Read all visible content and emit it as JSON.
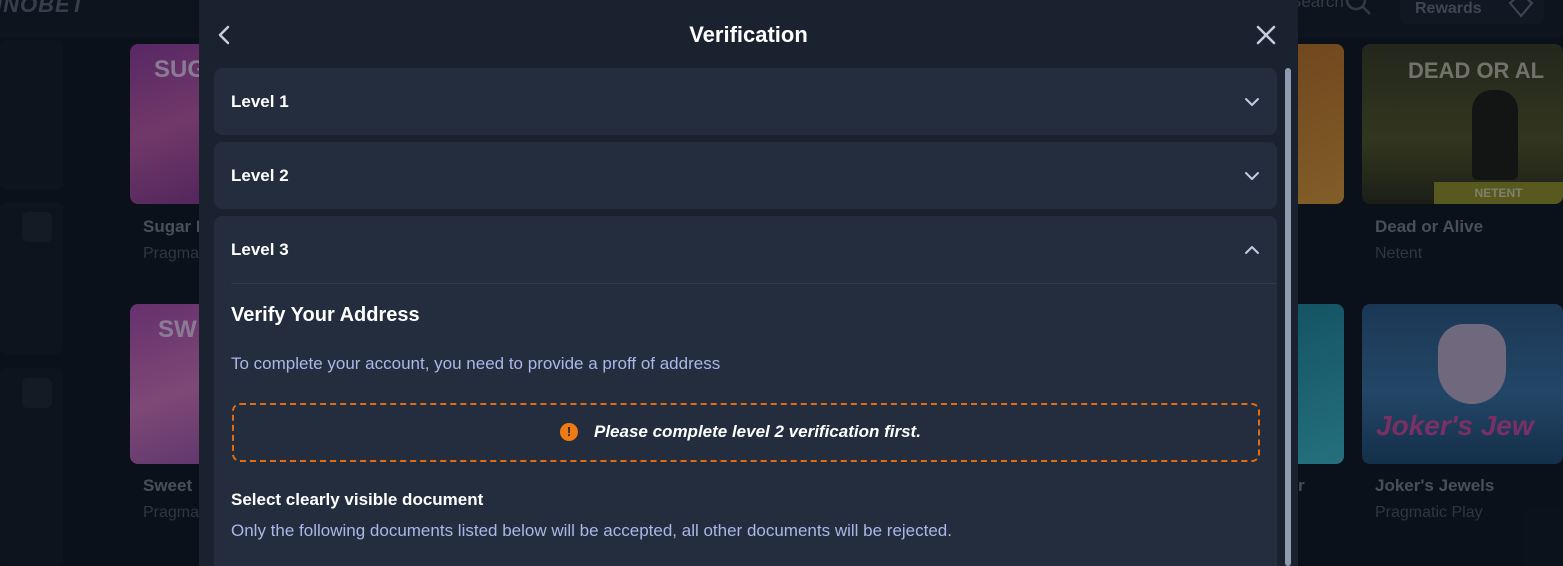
{
  "background": {
    "logo": "INOBET",
    "search_label": "Search",
    "rewards_label": "Rewards",
    "games": [
      {
        "title": "Sugar R",
        "provider": "Pragmatic",
        "banner": "SUG"
      },
      {
        "title": "Dead or Alive",
        "provider": "Netent",
        "banner": "DEAD OR AL",
        "badge": "NETENT"
      },
      {
        "title": "Sweet",
        "provider": "Pragmatic",
        "banner": "SW"
      },
      {
        "title": "r",
        "provider": ""
      },
      {
        "title": "Joker's Jewels",
        "provider": "Pragmatic Play",
        "banner": "Joker's Jew"
      }
    ]
  },
  "modal": {
    "title": "Verification",
    "levels": [
      {
        "label": "Level 1",
        "expanded": false
      },
      {
        "label": "Level 2",
        "expanded": false
      },
      {
        "label": "Level 3",
        "expanded": true
      }
    ],
    "level3": {
      "heading": "Verify Your Address",
      "description": "To complete your account, you need to provide a proff of address",
      "warning_icon": "!",
      "warning": "Please complete level 2 verification first.",
      "select_heading": "Select clearly visible document",
      "select_note": "Only the following documents listed below will be accepted, all other documents will be rejected."
    }
  },
  "colors": {
    "modal_bg": "#1a2230",
    "accordion_bg": "#232d3d",
    "accent_text": "#aab7e8",
    "warning": "#e36c12"
  }
}
